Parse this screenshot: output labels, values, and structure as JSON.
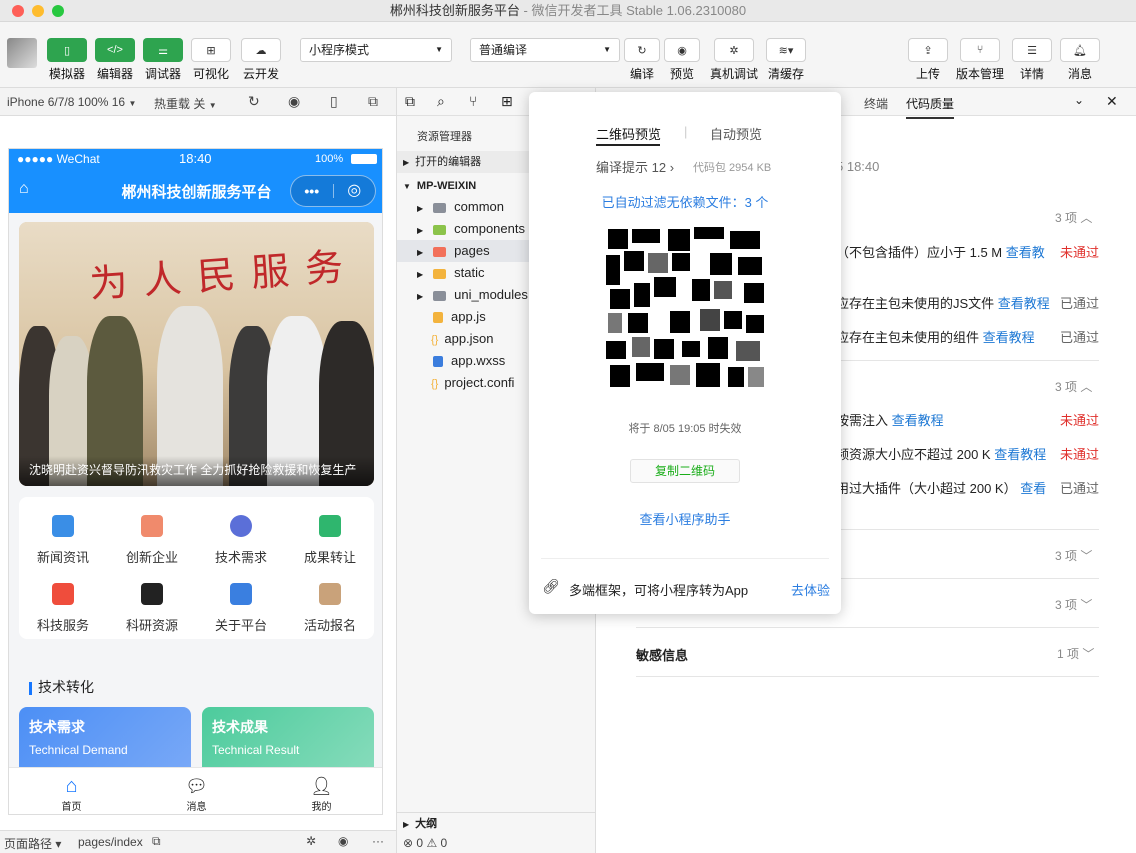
{
  "window": {
    "title": "郴州科技创新服务平台",
    "subtitle": "微信开发者工具 Stable 1.06.2310080"
  },
  "toolbar": {
    "left_buttons": [
      "模拟器",
      "编辑器",
      "调试器",
      "可视化",
      "云开发"
    ],
    "mode_select": "小程序模式",
    "compile_select": "普通编译",
    "mid_buttons": [
      "编译",
      "预览",
      "真机调试",
      "清缓存"
    ],
    "right_buttons": [
      "上传",
      "版本管理",
      "详情",
      "消息"
    ]
  },
  "simbar": {
    "device": "iPhone 6/7/8 100% 16",
    "hot_reload": "热重载 关"
  },
  "phone": {
    "status": {
      "carrier": "●●●●● WeChat",
      "time": "18:40",
      "battery": "100%"
    },
    "nav_title": "郴州科技创新服务平台",
    "banner_caption": "沈晓明赴资兴督导防汛救灾工作 全力抓好抢险救援和恢复生产",
    "banner_calligraphy": "为人民服务",
    "menu": [
      {
        "label": "新闻资讯",
        "color": "#3a8ee6"
      },
      {
        "label": "创新企业",
        "color": "#f08a6c"
      },
      {
        "label": "技术需求",
        "color": "#5b6fd8"
      },
      {
        "label": "成果转让",
        "color": "#2fb66e"
      },
      {
        "label": "科技服务",
        "color": "#ef4d3c"
      },
      {
        "label": "科研资源",
        "color": "#222222"
      },
      {
        "label": "关于平台",
        "color": "#3a7fe0"
      },
      {
        "label": "活动报名",
        "color": "#c9a27a"
      }
    ],
    "section_title": "技术转化",
    "cards": [
      {
        "title": "技术需求",
        "subtitle": "Technical Demand"
      },
      {
        "title": "技术成果",
        "subtitle": "Technical Result"
      }
    ],
    "tabs": [
      "首页",
      "消息",
      "我的"
    ]
  },
  "filepanel": {
    "title": "资源管理器",
    "open_editors": "打开的编辑器",
    "project": "MP-WEIXIN",
    "items": [
      {
        "name": "common",
        "type": "folder",
        "color": "#8a8f99"
      },
      {
        "name": "components",
        "type": "folder",
        "color": "#8bc34a"
      },
      {
        "name": "pages",
        "type": "folder",
        "color": "#f2705a"
      },
      {
        "name": "static",
        "type": "folder",
        "color": "#f3b33d"
      },
      {
        "name": "uni_modules",
        "type": "folder",
        "color": "#8a8f99"
      },
      {
        "name": "app.js",
        "type": "file",
        "color": "#f3b33d"
      },
      {
        "name": "app.json",
        "type": "file",
        "color": "#f3b33d"
      },
      {
        "name": "app.wxss",
        "type": "file",
        "color": "#3b7ddd"
      },
      {
        "name": "project.confi",
        "type": "file",
        "color": "#f3b33d"
      }
    ],
    "outline": "大纲"
  },
  "rightpanel": {
    "tabs": [
      "终端",
      "代码质量"
    ],
    "time_text": "5 18:40",
    "groups": [
      {
        "count": "3 项",
        "rows": [
          {
            "text": "（不包含插件）应小于 1.5 M",
            "link": "查看教",
            "status": "未通过"
          },
          {
            "text": "应存在主包未使用的JS文件",
            "link": "查看教程",
            "status": "已通过"
          },
          {
            "text": "应存在主包未使用的组件",
            "link": "查看教程",
            "status": "已通过"
          }
        ]
      },
      {
        "count": "3 项",
        "rows": [
          {
            "text": "按需注入",
            "link": "查看教程",
            "status": "未通过"
          },
          {
            "text": "频资源大小应不超过 200 K",
            "link": "查看教程",
            "status": "未通过"
          },
          {
            "text": "用过大插件（大小超过 200 K）",
            "link": "查看",
            "status": "已通过"
          }
        ]
      },
      {
        "count": "3 项",
        "rows": []
      },
      {
        "count": "3 项",
        "rows": []
      }
    ],
    "sensitive_label": "敏感信息",
    "sensitive_count": "1 项"
  },
  "popup": {
    "tab_active": "二维码预览",
    "tab_inactive": "自动预览",
    "compile_hint": "编译提示 12",
    "package_size": "代码包 2954 KB",
    "filtered": "已自动过滤无依赖文件：3 个",
    "expire": "将于 8/05 19:05 时失效",
    "copy_button": "复制二维码",
    "assistant_link": "查看小程序助手",
    "footer_text": "多端框架，可将小程序转为App",
    "footer_link": "去体验"
  },
  "bottombar": {
    "path_label": "页面路径",
    "path_value": "pages/index",
    "errors": "0",
    "warnings": "0"
  }
}
